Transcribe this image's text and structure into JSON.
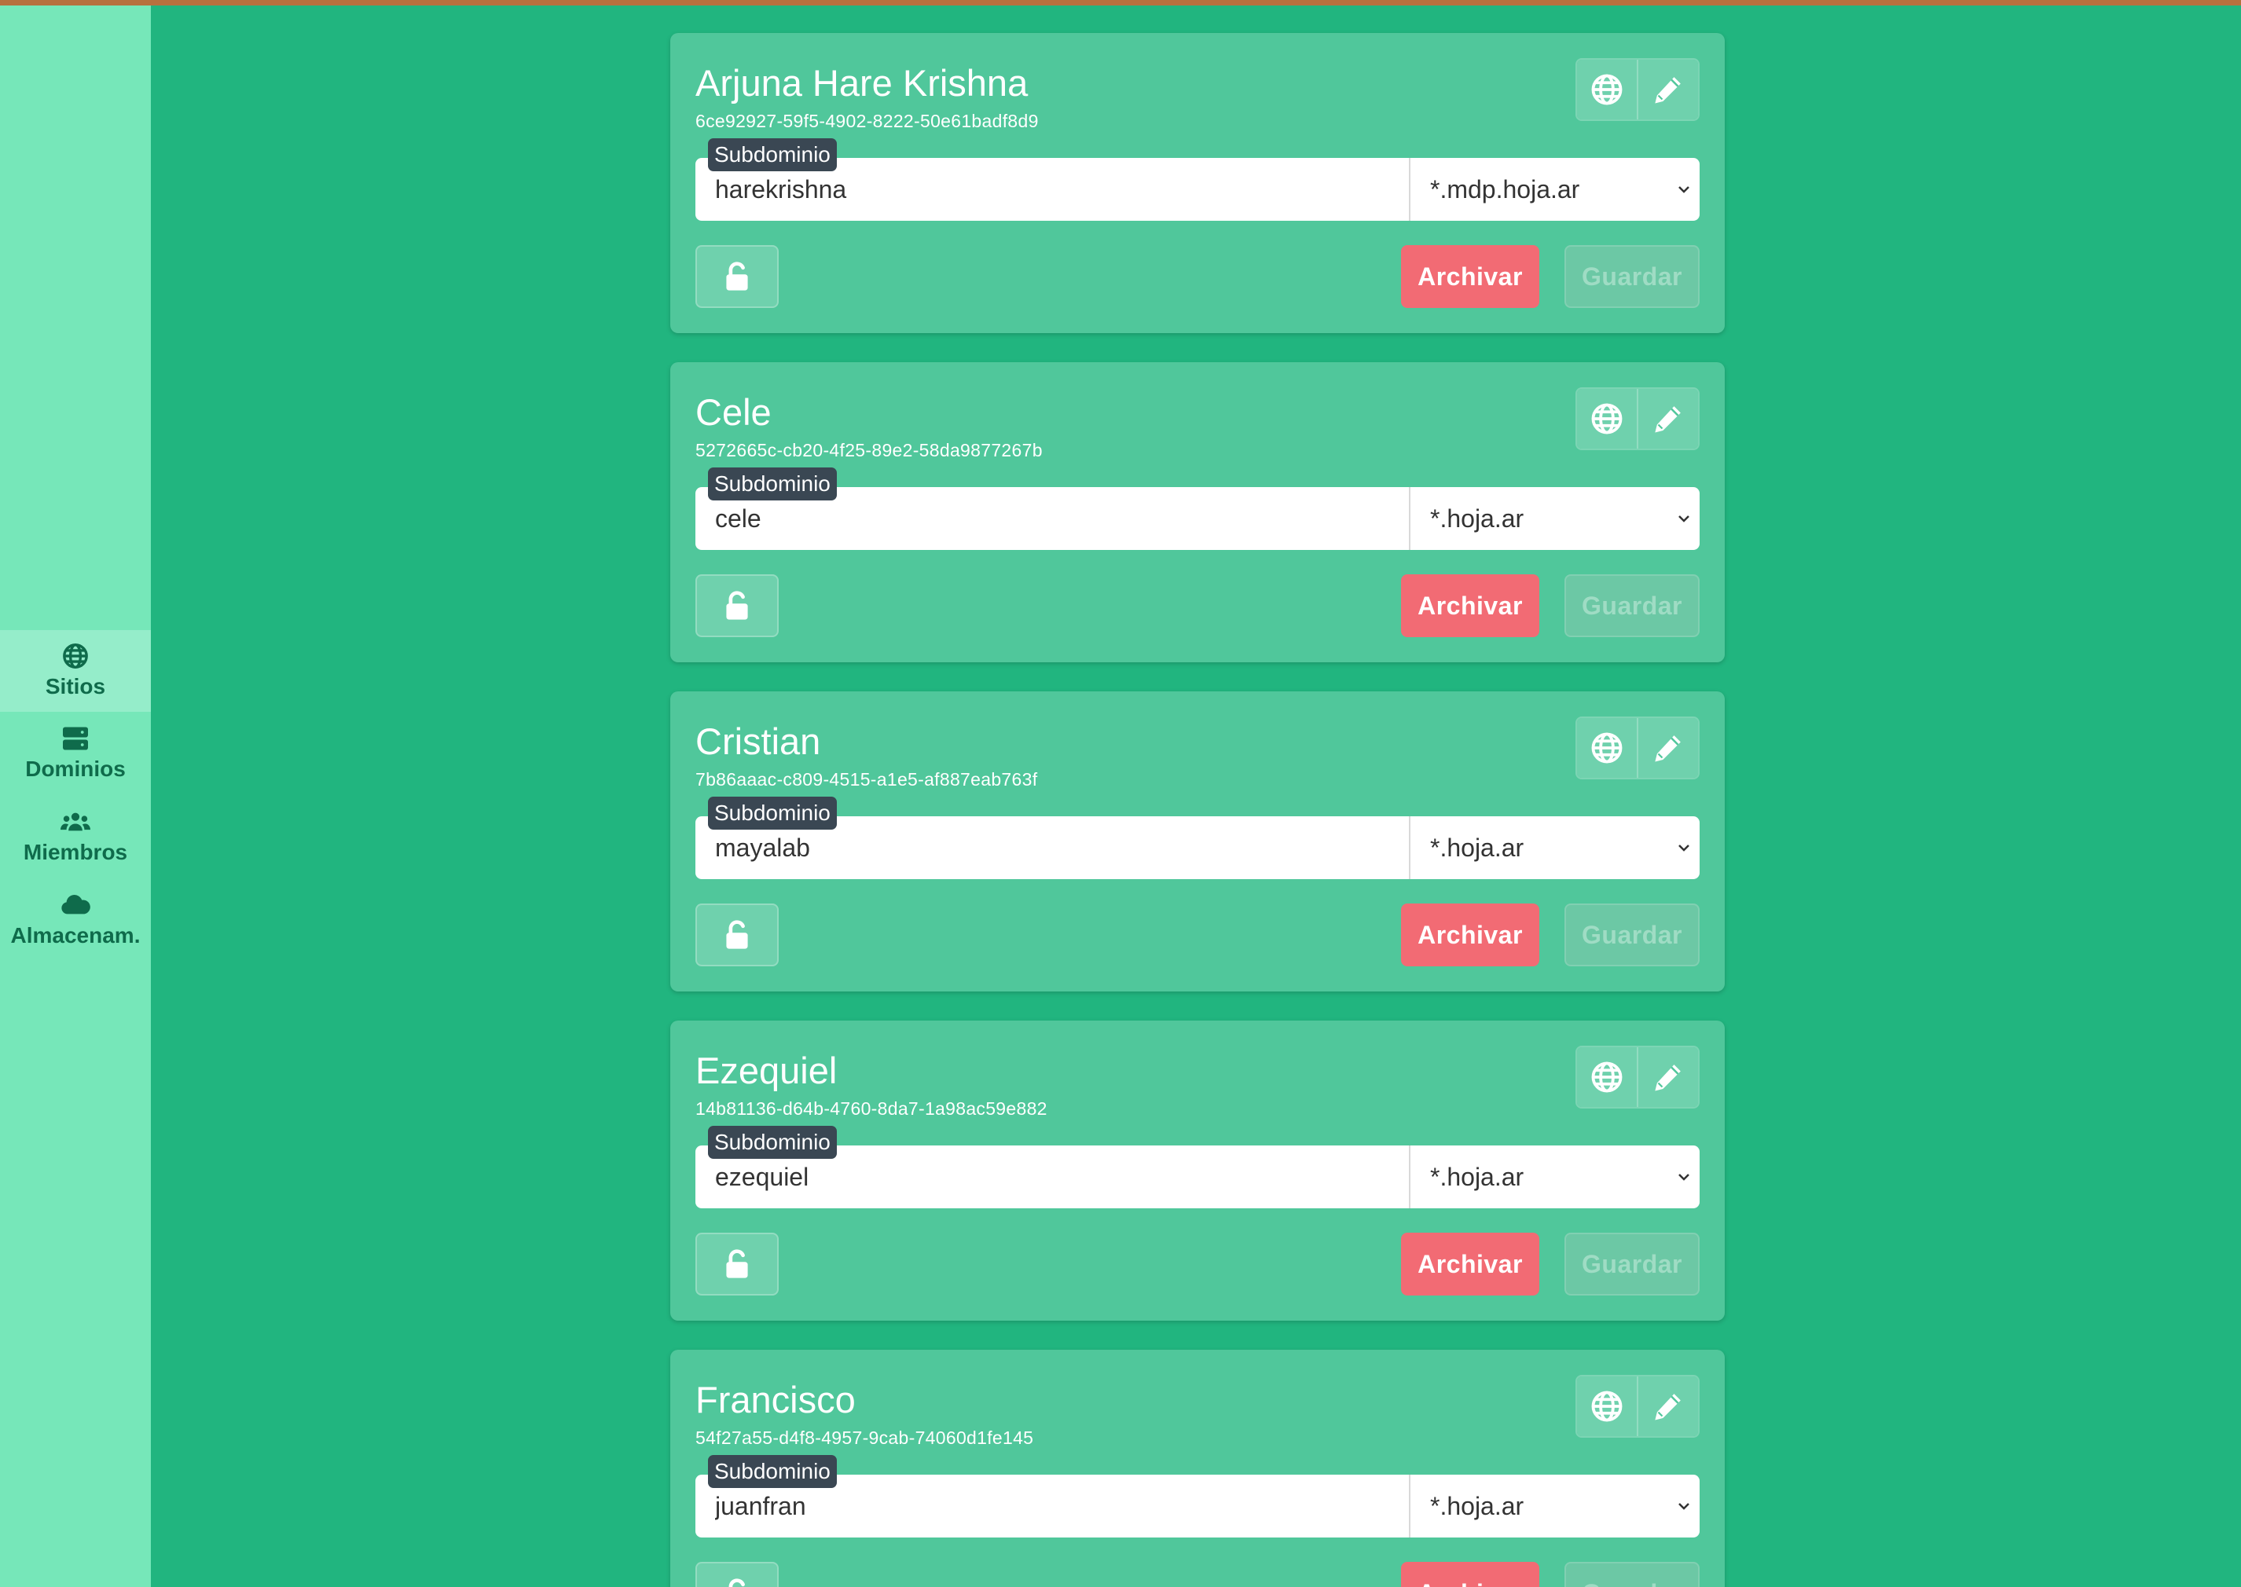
{
  "sidebar": {
    "items": [
      {
        "label": "Sitios",
        "icon": "globe-icon",
        "active": true
      },
      {
        "label": "Dominios",
        "icon": "server-icon",
        "active": false
      },
      {
        "label": "Miembros",
        "icon": "users-icon",
        "active": false
      },
      {
        "label": "Almacenam.",
        "icon": "cloud-icon",
        "active": false
      }
    ]
  },
  "sites": [
    {
      "name": "Arjuna Hare Krishna",
      "id": "6ce92927-59f5-4902-8222-50e61badf8d9",
      "subdomain_label": "Subdominio",
      "subdomain": "harekrishna",
      "domain": "*.mdp.hoja.ar",
      "archive_label": "Archivar",
      "save_label": "Guardar"
    },
    {
      "name": "Cele",
      "id": "5272665c-cb20-4f25-89e2-58da9877267b",
      "subdomain_label": "Subdominio",
      "subdomain": "cele",
      "domain": "*.hoja.ar",
      "archive_label": "Archivar",
      "save_label": "Guardar"
    },
    {
      "name": "Cristian",
      "id": "7b86aaac-c809-4515-a1e5-af887eab763f",
      "subdomain_label": "Subdominio",
      "subdomain": "mayalab",
      "domain": "*.hoja.ar",
      "archive_label": "Archivar",
      "save_label": "Guardar"
    },
    {
      "name": "Ezequiel",
      "id": "14b81136-d64b-4760-8da7-1a98ac59e882",
      "subdomain_label": "Subdominio",
      "subdomain": "ezequiel",
      "domain": "*.hoja.ar",
      "archive_label": "Archivar",
      "save_label": "Guardar"
    },
    {
      "name": "Francisco",
      "id": "54f27a55-d4f8-4957-9cab-74060d1fe145",
      "subdomain_label": "Subdominio",
      "subdomain": "juanfran",
      "domain": "*.hoja.ar",
      "archive_label": "Archivar",
      "save_label": "Guardar"
    }
  ],
  "colors": {
    "background": "#21b57f",
    "sidebar": "#76e7b9",
    "card": "#50c79b",
    "archive": "#f26b74",
    "badge": "#3a4753"
  }
}
